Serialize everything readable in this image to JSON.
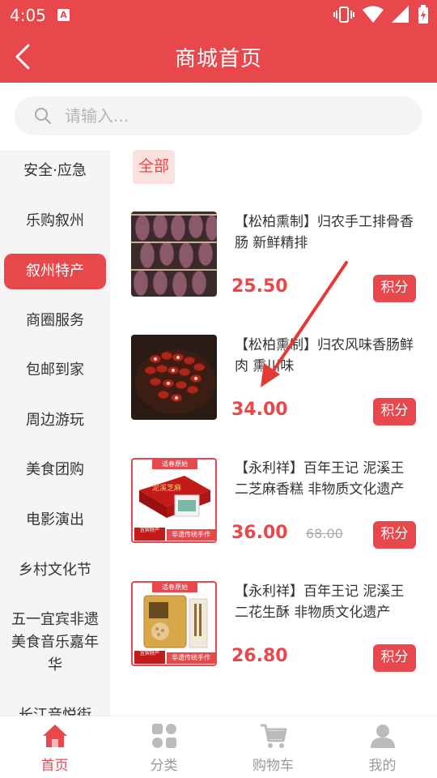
{
  "status": {
    "time": "4:05",
    "app_indicator": "A"
  },
  "header": {
    "title": "商城首页"
  },
  "search": {
    "placeholder": "请输入..."
  },
  "sidebar": {
    "items": [
      {
        "label": "安全·应急"
      },
      {
        "label": "乐购叙州"
      },
      {
        "label": "叙州特产",
        "active": true
      },
      {
        "label": "商圈服务"
      },
      {
        "label": "包邮到家"
      },
      {
        "label": "周边游玩"
      },
      {
        "label": "美食团购"
      },
      {
        "label": "电影演出"
      },
      {
        "label": "乡村文化节"
      },
      {
        "label": "五一宜宾非遗美食音乐嘉年华"
      },
      {
        "label": "长江音悦街"
      }
    ]
  },
  "filter": {
    "all_label": "全部"
  },
  "products": [
    {
      "title": "【松柏熏制】归农手工排骨香肠 新鲜精排",
      "price": "25.50",
      "button": "积分",
      "image": "sausage-rack-photo"
    },
    {
      "title": "【松柏熏制】归农风味香肠鲜肉 熏川味",
      "price": "34.00",
      "button": "积分",
      "image": "sausage-plate-photo"
    },
    {
      "title": "【永利祥】百年王记 泥溪王二芝麻香糕 非物质文化遗产",
      "price": "36.00",
      "old_price": "68.00",
      "button": "积分",
      "image": "sesame-cake-box-photo"
    },
    {
      "title": "【永利祥】百年王记 泥溪王二花生酥 非物质文化遗产",
      "price": "26.80",
      "button": "积分",
      "image": "peanut-crisp-bag-photo"
    }
  ],
  "product_image_text": {
    "banner": "适春原始",
    "badge_left": "宜宾特产",
    "badge_right": "非遗传统手作",
    "box_text": "泥溪芝麻"
  },
  "nav": {
    "items": [
      {
        "label": "首页",
        "icon": "home-icon",
        "active": true
      },
      {
        "label": "分类",
        "icon": "category-icon"
      },
      {
        "label": "购物车",
        "icon": "cart-icon"
      },
      {
        "label": "我的",
        "icon": "user-icon"
      }
    ]
  },
  "colors": {
    "brand": "#e8484c",
    "tag_bg": "#fbe0e0",
    "sidebar_bg": "#f5f5f5",
    "muted": "#999999"
  }
}
